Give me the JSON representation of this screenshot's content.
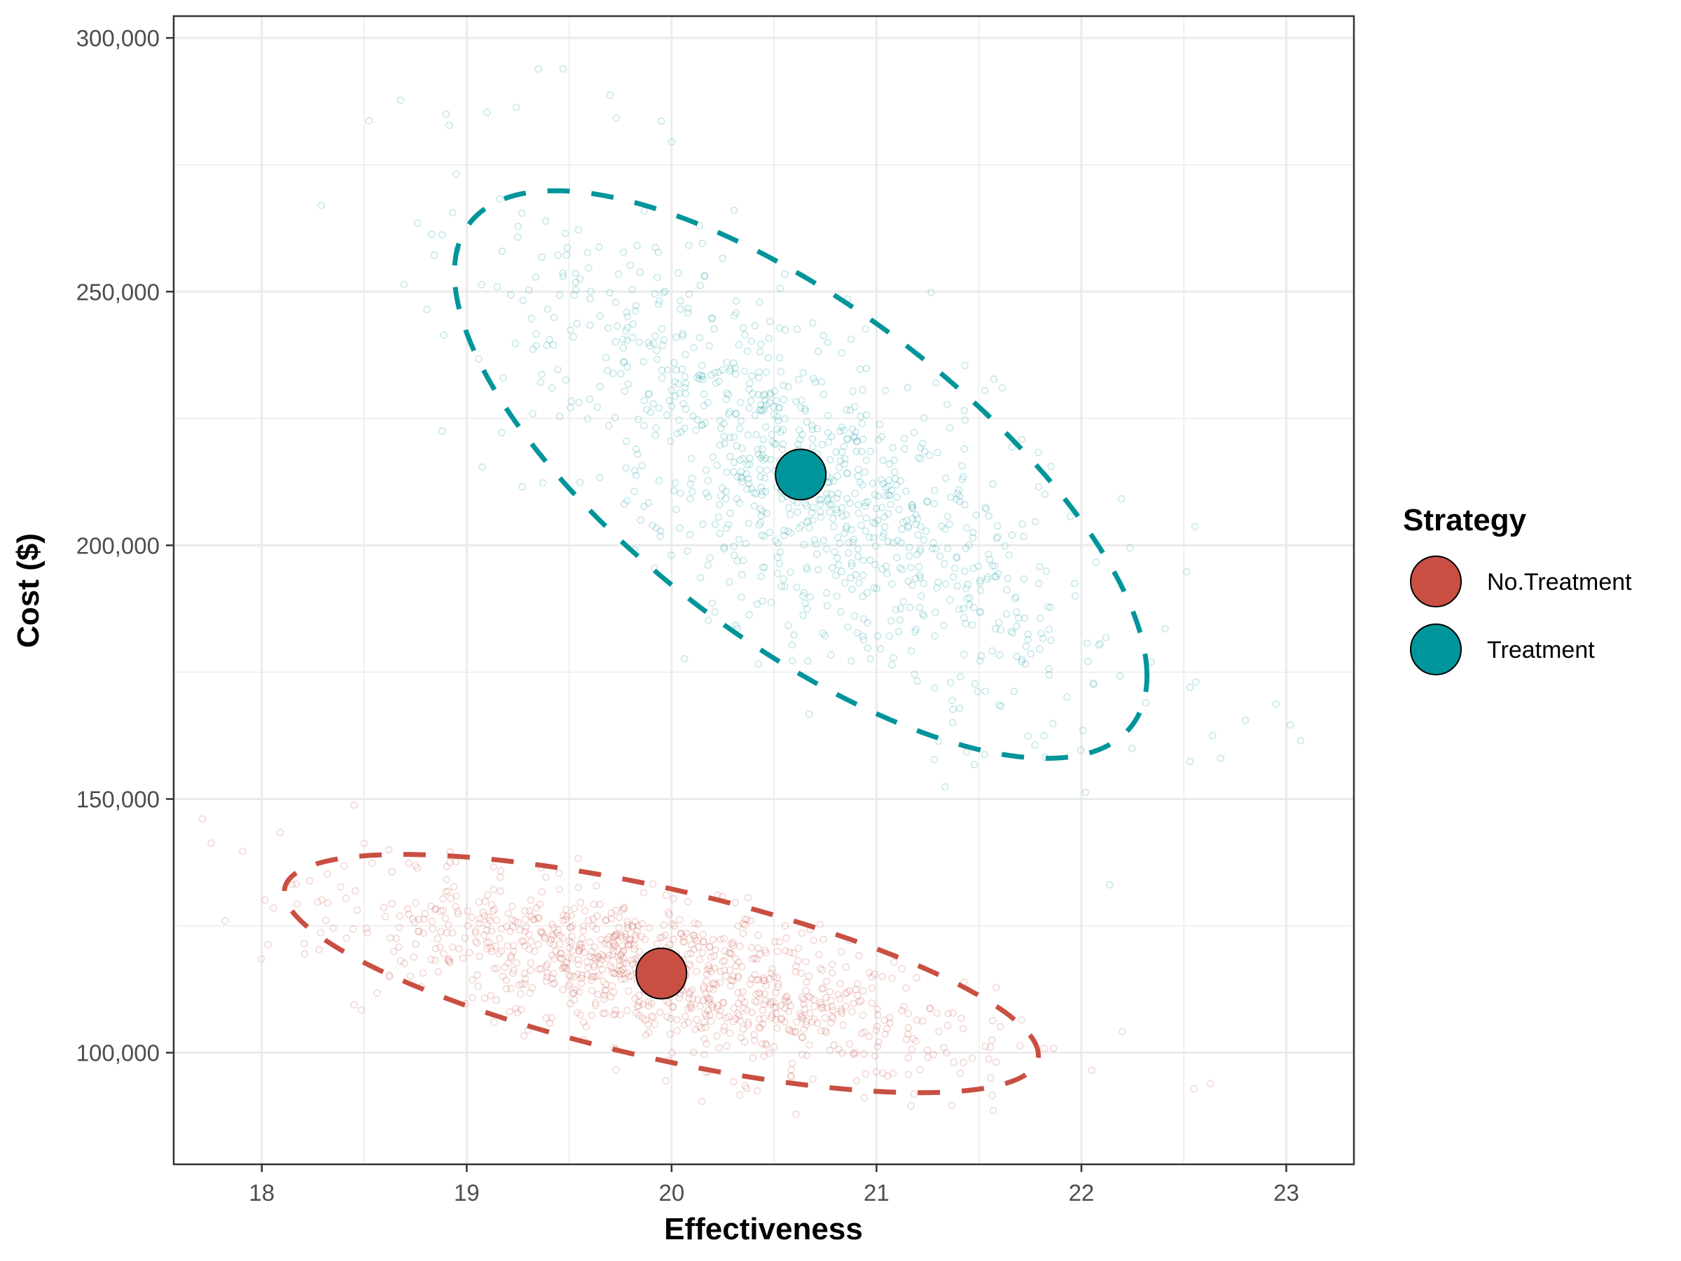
{
  "chart_data": {
    "type": "scatter",
    "title": "",
    "xlabel": "Effectiveness",
    "ylabel": "Cost ($)",
    "xlim": [
      17.57,
      23.33
    ],
    "ylim": [
      78000,
      304300
    ],
    "x_ticks": [
      18,
      19,
      20,
      21,
      22,
      23
    ],
    "x_tick_labels": [
      "18",
      "19",
      "20",
      "21",
      "22",
      "23"
    ],
    "y_ticks": [
      100000,
      150000,
      200000,
      250000,
      300000
    ],
    "y_tick_labels": [
      "100,000",
      "150,000",
      "200,000",
      "250,000",
      "300,000"
    ],
    "x_minor": [
      17.5,
      18.5,
      19.5,
      20.5,
      21.5,
      22.5,
      23.5
    ],
    "y_minor": [
      75000,
      125000,
      175000,
      225000,
      275000
    ],
    "grid": true,
    "legend": {
      "title": "Strategy",
      "position": "right",
      "entries": [
        "No.Treatment",
        "Treatment"
      ]
    },
    "series": [
      {
        "name": "No.Treatment",
        "color": "#C94F42",
        "mean": {
          "x": 19.95,
          "y": 115600
        },
        "sd": {
          "x": 0.75,
          "y": 9590
        },
        "correlation": -0.685,
        "n_samples": 1000,
        "ellipse": {
          "level": 0.95,
          "style": "dashed",
          "center": {
            "x": 19.95,
            "y": 115600
          },
          "x_halfwidth": 1.84,
          "y_halfheight": 23480,
          "correlation": -0.685
        },
        "outlier_points": [
          {
            "x": 17.82,
            "y": 126000
          },
          {
            "x": 18.03,
            "y": 121300
          },
          {
            "x": 18.45,
            "y": 148800
          },
          {
            "x": 22.2,
            "y": 104200
          },
          {
            "x": 22.55,
            "y": 92900
          },
          {
            "x": 22.63,
            "y": 93900
          },
          {
            "x": 21.57,
            "y": 88600
          },
          {
            "x": 22.05,
            "y": 96500
          },
          {
            "x": 18.62,
            "y": 140000
          }
        ]
      },
      {
        "name": "Treatment",
        "color": "#00959A",
        "mean": {
          "x": 20.63,
          "y": 213950
        },
        "sd": {
          "x": 0.69,
          "y": 22850
        },
        "correlation": -0.71,
        "n_samples": 1000,
        "ellipse": {
          "level": 0.95,
          "style": "dashed",
          "center": {
            "x": 20.63,
            "y": 213950
          },
          "x_halfwidth": 1.69,
          "y_halfheight": 55940,
          "correlation": -0.71
        },
        "outlier_points": [
          {
            "x": 19.35,
            "y": 293900
          },
          {
            "x": 19.47,
            "y": 293900
          },
          {
            "x": 19.7,
            "y": 288700
          },
          {
            "x": 19.73,
            "y": 284200
          },
          {
            "x": 19.1,
            "y": 285300
          },
          {
            "x": 18.9,
            "y": 285000
          },
          {
            "x": 19.95,
            "y": 283600
          },
          {
            "x": 20.0,
            "y": 279500
          },
          {
            "x": 18.76,
            "y": 263500
          },
          {
            "x": 22.53,
            "y": 172000
          },
          {
            "x": 22.8,
            "y": 165500
          },
          {
            "x": 23.02,
            "y": 164600
          },
          {
            "x": 23.07,
            "y": 161500
          },
          {
            "x": 22.68,
            "y": 158000
          },
          {
            "x": 22.02,
            "y": 151300
          },
          {
            "x": 22.34,
            "y": 177000
          },
          {
            "x": 18.88,
            "y": 222500
          },
          {
            "x": 22.64,
            "y": 162500
          }
        ]
      }
    ]
  }
}
